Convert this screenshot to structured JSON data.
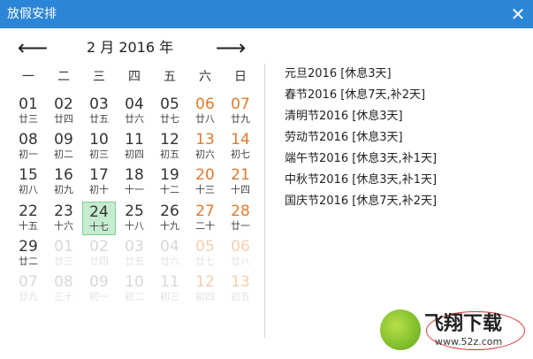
{
  "window": {
    "title": "放假安排",
    "close_icon": "close-icon"
  },
  "calendar": {
    "prev_glyph": "⟵",
    "next_glyph": "⟶",
    "month_label": "2 月  2016 年",
    "weekdays": [
      "一",
      "二",
      "三",
      "四",
      "五",
      "六",
      "日"
    ],
    "weeks": [
      [
        {
          "num": "01",
          "lunar": "廿三"
        },
        {
          "num": "02",
          "lunar": "廿四"
        },
        {
          "num": "03",
          "lunar": "廿五"
        },
        {
          "num": "04",
          "lunar": "廿六"
        },
        {
          "num": "05",
          "lunar": "廿七"
        },
        {
          "num": "06",
          "lunar": "廿八"
        },
        {
          "num": "07",
          "lunar": "廿九"
        }
      ],
      [
        {
          "num": "08",
          "lunar": "初一"
        },
        {
          "num": "09",
          "lunar": "初二"
        },
        {
          "num": "10",
          "lunar": "初三"
        },
        {
          "num": "11",
          "lunar": "初四"
        },
        {
          "num": "12",
          "lunar": "初五"
        },
        {
          "num": "13",
          "lunar": "初六"
        },
        {
          "num": "14",
          "lunar": "初七"
        }
      ],
      [
        {
          "num": "15",
          "lunar": "初八"
        },
        {
          "num": "16",
          "lunar": "初九"
        },
        {
          "num": "17",
          "lunar": "初十"
        },
        {
          "num": "18",
          "lunar": "十一"
        },
        {
          "num": "19",
          "lunar": "十二"
        },
        {
          "num": "20",
          "lunar": "十三"
        },
        {
          "num": "21",
          "lunar": "十四"
        }
      ],
      [
        {
          "num": "22",
          "lunar": "十五"
        },
        {
          "num": "23",
          "lunar": "十六"
        },
        {
          "num": "24",
          "lunar": "十七",
          "selected": true
        },
        {
          "num": "25",
          "lunar": "十八"
        },
        {
          "num": "26",
          "lunar": "十九"
        },
        {
          "num": "27",
          "lunar": "二十"
        },
        {
          "num": "28",
          "lunar": "廿一"
        }
      ],
      [
        {
          "num": "29",
          "lunar": "廿二"
        },
        {
          "num": "01",
          "lunar": "廿三",
          "faded": true
        },
        {
          "num": "02",
          "lunar": "廿四",
          "faded": true
        },
        {
          "num": "03",
          "lunar": "廿五",
          "faded": true
        },
        {
          "num": "04",
          "lunar": "廿六",
          "faded": true
        },
        {
          "num": "05",
          "lunar": "廿七",
          "faded": true
        },
        {
          "num": "06",
          "lunar": "廿八",
          "faded": true
        }
      ],
      [
        {
          "num": "07",
          "lunar": "廿九",
          "faded": true
        },
        {
          "num": "08",
          "lunar": "三十",
          "faded": true
        },
        {
          "num": "09",
          "lunar": "初一",
          "faded": true
        },
        {
          "num": "10",
          "lunar": "初二",
          "faded": true
        },
        {
          "num": "11",
          "lunar": "初三",
          "faded": true
        },
        {
          "num": "12",
          "lunar": "初四",
          "faded": true
        },
        {
          "num": "13",
          "lunar": "初五",
          "faded": true
        }
      ]
    ]
  },
  "holidays": [
    "元旦2016 [休息3天]",
    "春节2016 [休息7天,补2天]",
    "清明节2016 [休息3天]",
    "劳动节2016 [休息3天]",
    "端午节2016 [休息3天,补1天]",
    "中秋节2016 [休息3天,补1天]",
    "国庆节2016 [休息7天,补2天]"
  ],
  "watermark": {
    "brand": "飞翔下载",
    "url": "www.52z.com"
  },
  "colors": {
    "titlebar": "#2b86d8",
    "weekend": "#e07a2a",
    "selected_bg": "#c6ecd0"
  }
}
